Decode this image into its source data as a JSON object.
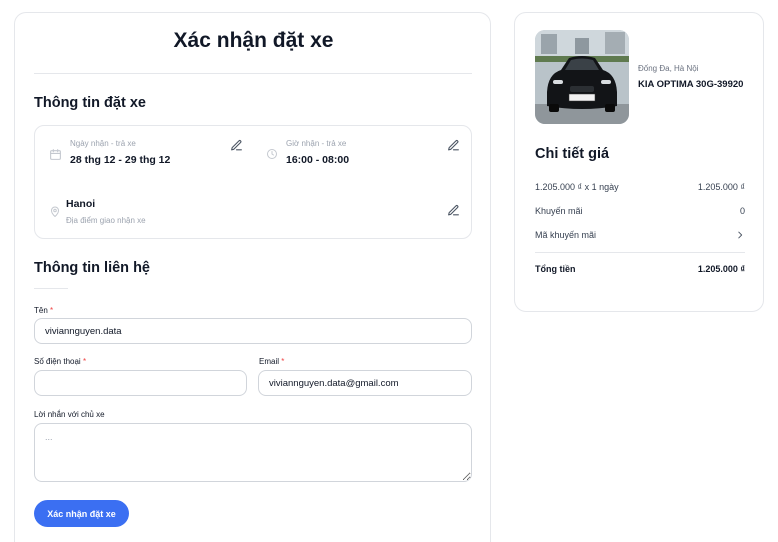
{
  "page_title": "Xác nhận đặt xe",
  "booking": {
    "section_title": "Thông tin đặt xe",
    "date_label": "Ngày nhận - trả xe",
    "date_value": "28 thg 12 - 29 thg 12",
    "time_label": "Giờ nhận - trả xe",
    "time_value": "16:00 - 08:00",
    "location_value": "Hanoi",
    "location_label": "Địa điểm giao nhận xe"
  },
  "contact": {
    "section_title": "Thông tin liên hệ",
    "name_label": "Tên",
    "name_value": "viviannguyen.data",
    "phone_label": "Số điện thoại",
    "phone_value": "",
    "email_label": "Email",
    "email_value": "viviannguyen.data@gmail.com",
    "message_label": "Lời nhắn với chủ xe",
    "message_placeholder": "...",
    "required_mark": "*",
    "submit_label": "Xác nhận đặt xe"
  },
  "car": {
    "location": "Đống Đa, Hà Nội",
    "name": "KIA OPTIMA 30G-39920",
    "plate": "30G-399.20"
  },
  "price": {
    "title": "Chi tiết giá",
    "rows": [
      {
        "label": "1.205.000 ₫ x 1 ngày",
        "value": "1.205.000 ₫"
      },
      {
        "label": "Khuyến mãi",
        "value": "0"
      },
      {
        "label": "Mã khuyến mãi",
        "value": ""
      }
    ],
    "total_label": "Tổng tiền",
    "total_value": "1.205.000 ₫"
  },
  "colors": {
    "accent": "#3b6ff2",
    "required": "#ef4444",
    "border": "#e5e7eb"
  }
}
